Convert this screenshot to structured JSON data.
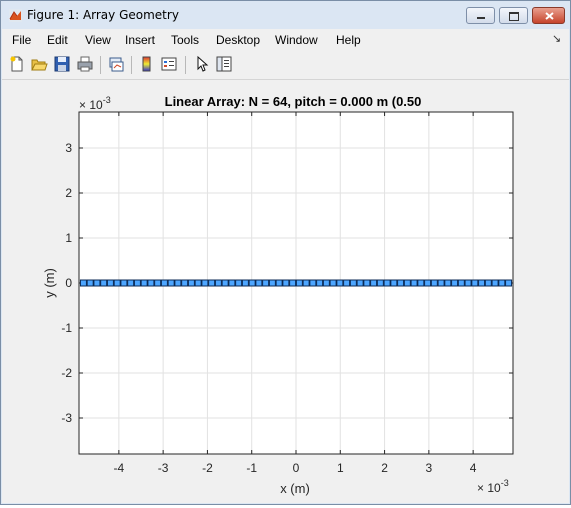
{
  "window": {
    "title": "Figure 1: Array Geometry"
  },
  "menu": [
    "File",
    "Edit",
    "View",
    "Insert",
    "Tools",
    "Desktop",
    "Window",
    "Help"
  ],
  "toolbar_icons": [
    "new-figure-icon",
    "open-file-icon",
    "save-icon",
    "print-icon",
    "link-plot-icon",
    "colorbar-icon",
    "legend-icon",
    "pointer-icon",
    "property-editor-icon"
  ],
  "chart_data": {
    "type": "scatter",
    "title": "Linear Array: N = 64, pitch = 0.000 m (0.50",
    "xlabel": "x (m)",
    "ylabel": "y (m)",
    "xlim": [
      -4.9,
      4.9
    ],
    "ylim": [
      -3.8,
      3.8
    ],
    "x_exponent": "10",
    "x_exponent_power": "-3",
    "y_exponent": "10",
    "y_exponent_power": "-3",
    "exponent_prefix": "×",
    "xticks": [
      -4,
      -3,
      -2,
      -1,
      0,
      1,
      2,
      3,
      4
    ],
    "yticks": [
      -3,
      -2,
      -1,
      0,
      1,
      2,
      3
    ],
    "grid": true,
    "marker": "square",
    "marker_color": "#4da6ff",
    "n_points": 64,
    "x_min": -4.8,
    "x_max": 4.8,
    "y_value": 0
  }
}
